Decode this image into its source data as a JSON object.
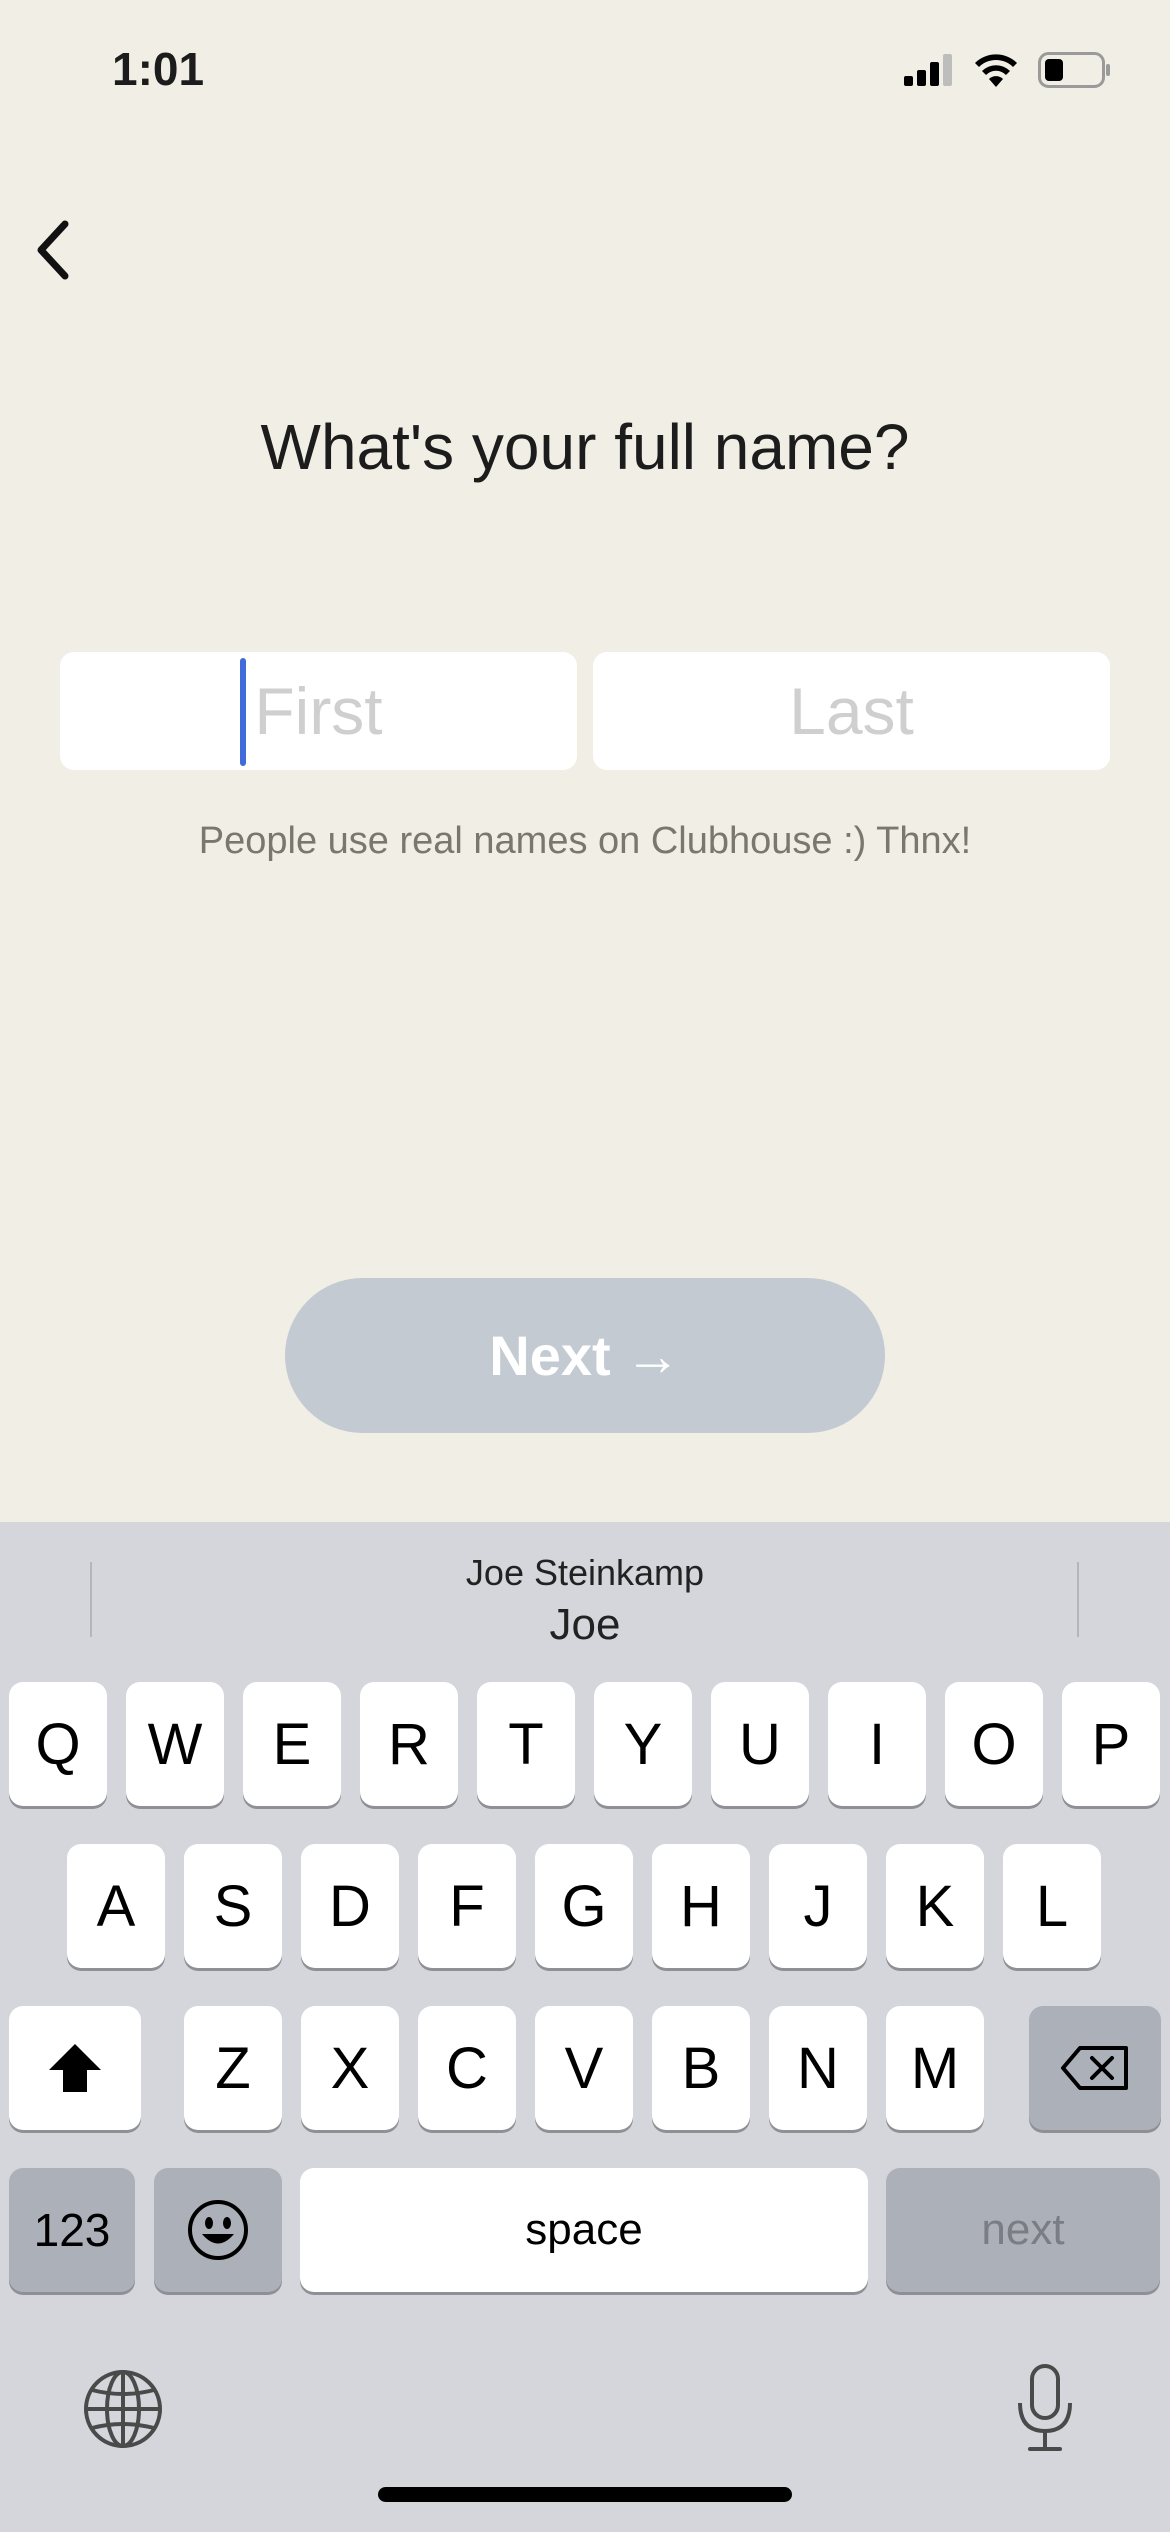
{
  "status_bar": {
    "time": "1:01"
  },
  "header": {
    "title": "What's your full name?"
  },
  "form": {
    "first_placeholder": "First",
    "last_placeholder": "Last",
    "hint": "People use real names on Clubhouse :) Thnx!"
  },
  "actions": {
    "next_label": "Next",
    "next_arrow": "→"
  },
  "keyboard": {
    "suggestion_secondary": "Joe Steinkamp",
    "suggestion_primary": "Joe",
    "row1": [
      "Q",
      "W",
      "E",
      "R",
      "T",
      "Y",
      "U",
      "I",
      "O",
      "P"
    ],
    "row2": [
      "A",
      "S",
      "D",
      "F",
      "G",
      "H",
      "J",
      "K",
      "L"
    ],
    "row3": [
      "Z",
      "X",
      "C",
      "V",
      "B",
      "N",
      "M"
    ],
    "numbers_label": "123",
    "space_label": "space",
    "return_label": "next"
  },
  "colors": {
    "background": "#F1EFE5",
    "accent_caret": "#3F6BDB",
    "button_disabled": "#C3CAD1",
    "keyboard_bg": "#D4D6DB"
  }
}
